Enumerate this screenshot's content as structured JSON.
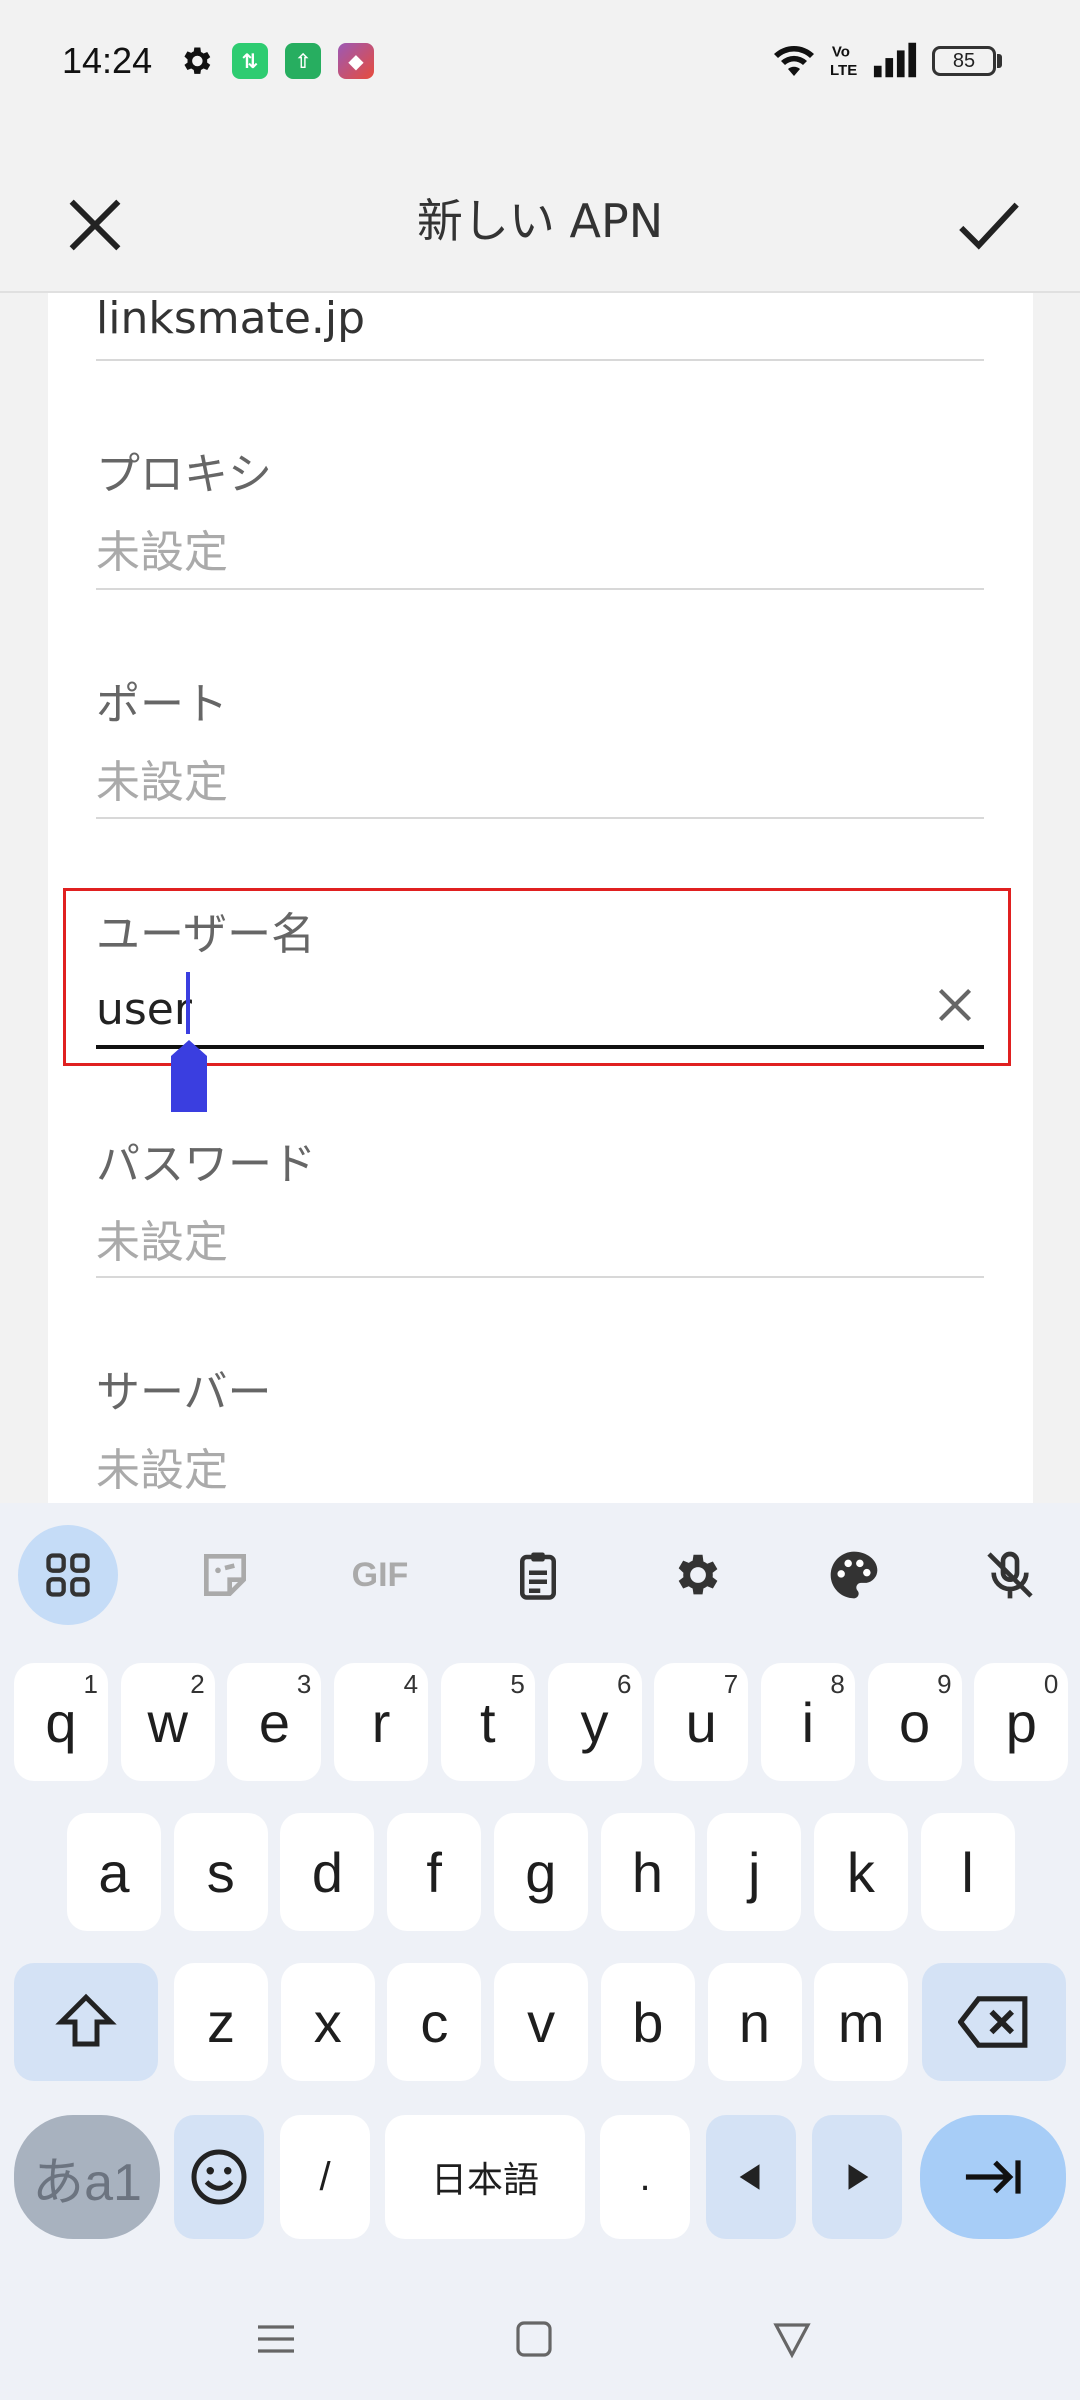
{
  "status_bar": {
    "time": "14:24",
    "battery": "85",
    "icons": [
      "gear-icon",
      "data-transfer-icon",
      "upload-icon",
      "shortcut-app-icon",
      "wifi-icon",
      "volte-icon",
      "signal-icon",
      "battery-icon"
    ]
  },
  "app_bar": {
    "title": "新しい APN",
    "close_icon": "close-icon",
    "confirm_icon": "check-icon"
  },
  "form": {
    "top_value": "linksmate.jp",
    "fields": [
      {
        "label": "プロキシ",
        "value": "未設定"
      },
      {
        "label": "ポート",
        "value": "未設定"
      },
      {
        "label": "ユーザー名",
        "value": "user",
        "active": true
      },
      {
        "label": "パスワード",
        "value": "未設定"
      },
      {
        "label": "サーバー",
        "value": "未設定"
      }
    ]
  },
  "keyboard": {
    "toolbar": [
      "apps-grid-icon",
      "sticker-icon",
      "GIF",
      "clipboard-icon",
      "settings-icon",
      "palette-icon",
      "mic-off-icon"
    ],
    "row1": [
      {
        "k": "q",
        "n": "1"
      },
      {
        "k": "w",
        "n": "2"
      },
      {
        "k": "e",
        "n": "3"
      },
      {
        "k": "r",
        "n": "4"
      },
      {
        "k": "t",
        "n": "5"
      },
      {
        "k": "y",
        "n": "6"
      },
      {
        "k": "u",
        "n": "7"
      },
      {
        "k": "i",
        "n": "8"
      },
      {
        "k": "o",
        "n": "9"
      },
      {
        "k": "p",
        "n": "0"
      }
    ],
    "row2": [
      "a",
      "s",
      "d",
      "f",
      "g",
      "h",
      "j",
      "k",
      "l"
    ],
    "row3": [
      "z",
      "x",
      "c",
      "v",
      "b",
      "n",
      "m"
    ],
    "mode_key": "あa1",
    "slash": "/",
    "space": "日本語",
    "period": "."
  },
  "navbar": [
    "menu-icon",
    "home-icon",
    "back-icon"
  ]
}
